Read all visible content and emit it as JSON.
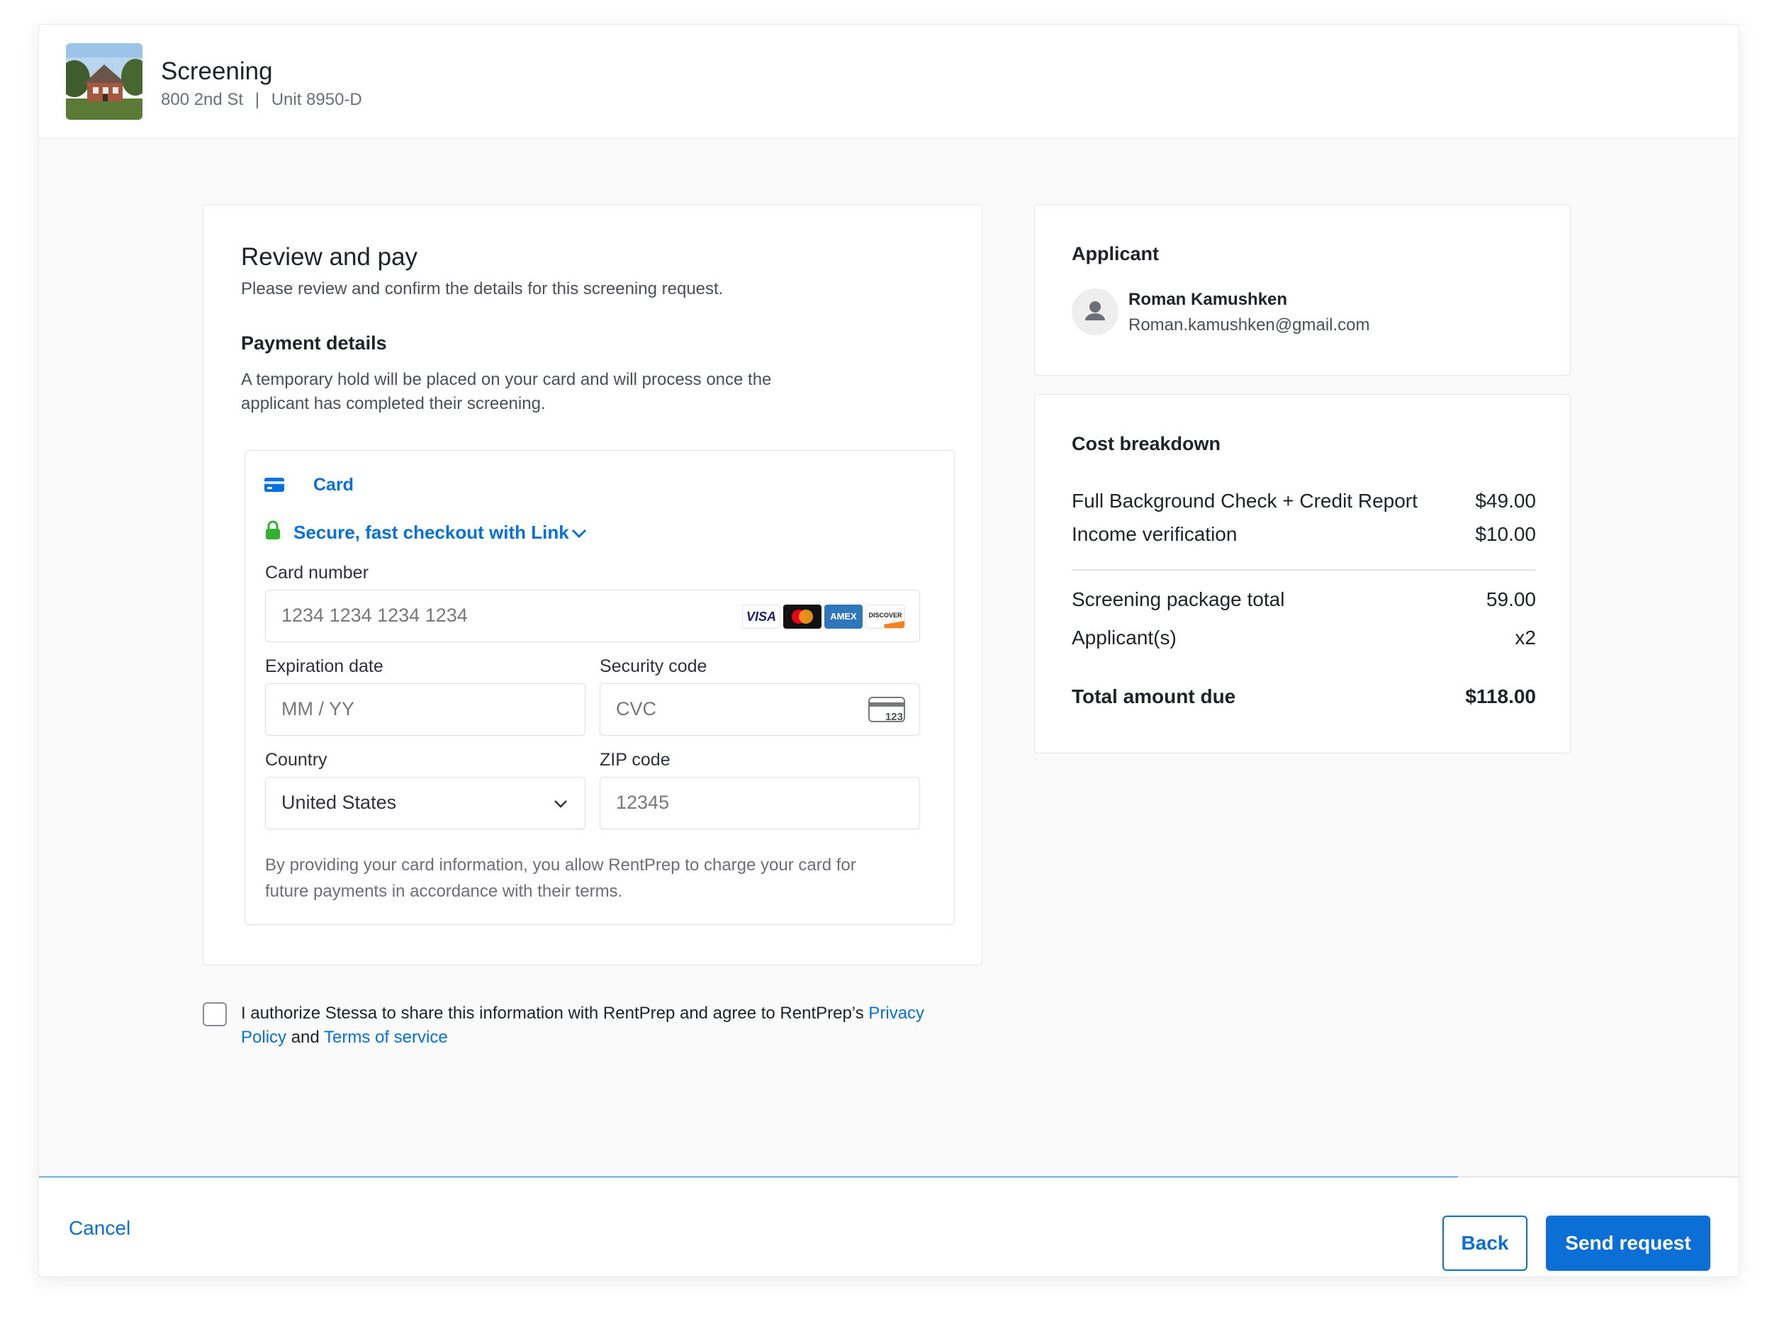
{
  "header": {
    "title": "Screening",
    "address": "800 2nd St",
    "unit": "Unit 8950-D",
    "separator": "|"
  },
  "review": {
    "title": "Review and pay",
    "subtitle": "Please review and confirm the details for this screening request.",
    "payment_title": "Payment details",
    "payment_desc_line1": "A temporary hold will be placed on your card and will process once the",
    "payment_desc_line2": "applicant has completed their screening."
  },
  "payment_form": {
    "method_tab": "Card",
    "link_text": "Secure, fast checkout with Link",
    "card_number_label": "Card number",
    "card_number_placeholder": "1234 1234 1234 1234",
    "brands": [
      "VISA",
      "mastercard",
      "AMEX",
      "DISCOVER"
    ],
    "expiration_label": "Expiration date",
    "expiration_placeholder": "MM / YY",
    "security_label": "Security code",
    "security_placeholder": "CVC",
    "cvc_icon_text": "123",
    "country_label": "Country",
    "country_value": "United States",
    "zip_label": "ZIP code",
    "zip_placeholder": "12345",
    "disclaimer_line1": "By providing your card information, you allow RentPrep to charge your card for",
    "disclaimer_line2": "future payments in accordance with their terms."
  },
  "consent": {
    "text_start": "I authorize Stessa to share this information with RentPrep and agree to RentPrep’s ",
    "privacy_word1": "Privacy",
    "privacy_word2": "Policy",
    "and_text": " and ",
    "terms_link": "Terms of service",
    "checked": false
  },
  "applicant": {
    "section_title": "Applicant",
    "name": "Roman Kamushken",
    "email": "Roman.kamushken@gmail.com"
  },
  "cost": {
    "section_title": "Cost breakdown",
    "items": [
      {
        "label": "Full Background Check + Credit Report",
        "amount": "$49.00"
      },
      {
        "label": "Income verification",
        "amount": "$10.00"
      }
    ],
    "package_total_label": "Screening package total",
    "package_total_value": "59.00",
    "applicants_label": "Applicant(s)",
    "applicants_value": "x2",
    "total_label": "Total amount due",
    "total_value": "$118.00"
  },
  "footer": {
    "cancel": "Cancel",
    "back": "Back",
    "send": "Send request",
    "progress": 0.835
  },
  "colors": {
    "primary": "#0b6fd6",
    "link": "#0570de",
    "success": "#30b130"
  }
}
